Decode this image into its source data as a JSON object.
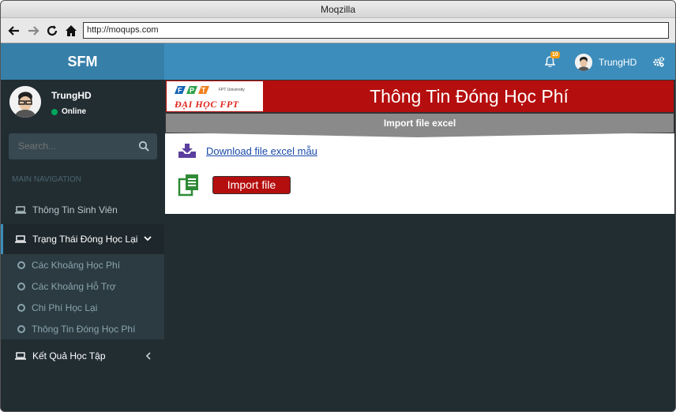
{
  "browser": {
    "title": "Moqzilla",
    "url": "http://moqups.com",
    "icons": [
      "back-icon",
      "forward-icon",
      "reload-icon",
      "home-icon"
    ]
  },
  "app": {
    "brand": "SFM",
    "colors": {
      "topbar": "#3c8dbc",
      "brand": "#367fa9",
      "sidebar": "#222d32",
      "accent_red": "#b50e0e"
    }
  },
  "sidebar": {
    "user": {
      "name": "TrungHD",
      "status": "Online"
    },
    "search": {
      "placeholder": "Search..."
    },
    "section_header": "MAIN NAVIGATION",
    "items": [
      {
        "label": "Thông Tin Sinh Viên"
      },
      {
        "label": "Trạng Thái Đóng Học Lại"
      },
      {
        "label": "Kết Quả Học Tập"
      }
    ],
    "submenu": [
      {
        "label": "Các Khoảng Học Phí"
      },
      {
        "label": "Các Khoảng Hỗ Trợ"
      },
      {
        "label": "Chi Phí Học Lại"
      },
      {
        "label": "Thông Tin Đóng Học Phí"
      }
    ]
  },
  "topbar": {
    "notification_count": "10",
    "user_name": "TrungHD"
  },
  "main": {
    "logo": {
      "top_text": "FPT University",
      "bottom_text": "ĐẠI HỌC FPT"
    },
    "banner_title": "Thông Tin Đóng Học Phí",
    "section_title": "Import file excel",
    "download_link": "Download file excel mẫu",
    "import_button": "Import file"
  }
}
